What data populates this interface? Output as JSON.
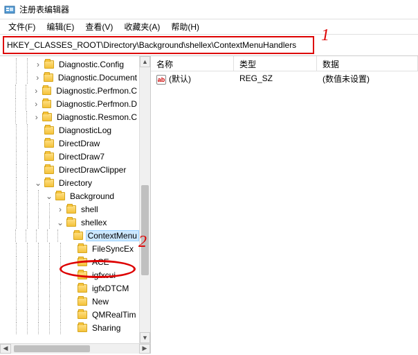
{
  "window": {
    "title": "注册表编辑器"
  },
  "menu": {
    "file": "文件(F)",
    "edit": "编辑(E)",
    "view": "查看(V)",
    "fav": "收藏夹(A)",
    "help": "帮助(H)"
  },
  "address": {
    "value": "HKEY_CLASSES_ROOT\\Directory\\Background\\shellex\\ContextMenuHandlers"
  },
  "tree": {
    "items": [
      {
        "label": "Diagnostic.Config",
        "depth": 3,
        "exp": "closed"
      },
      {
        "label": "Diagnostic.Document",
        "depth": 3,
        "exp": "closed"
      },
      {
        "label": "Diagnostic.Perfmon.C",
        "depth": 3,
        "exp": "closed"
      },
      {
        "label": "Diagnostic.Perfmon.D",
        "depth": 3,
        "exp": "closed"
      },
      {
        "label": "Diagnostic.Resmon.C",
        "depth": 3,
        "exp": "closed"
      },
      {
        "label": "DiagnosticLog",
        "depth": 3,
        "exp": "none"
      },
      {
        "label": "DirectDraw",
        "depth": 3,
        "exp": "none"
      },
      {
        "label": "DirectDraw7",
        "depth": 3,
        "exp": "none"
      },
      {
        "label": "DirectDrawClipper",
        "depth": 3,
        "exp": "none"
      },
      {
        "label": "Directory",
        "depth": 3,
        "exp": "open"
      },
      {
        "label": "Background",
        "depth": 4,
        "exp": "open"
      },
      {
        "label": "shell",
        "depth": 5,
        "exp": "closed"
      },
      {
        "label": "shellex",
        "depth": 5,
        "exp": "open"
      },
      {
        "label": "ContextMenu",
        "depth": 6,
        "exp": "none",
        "selected": true
      },
      {
        "label": "FileSyncEx",
        "depth": 6,
        "exp": "none"
      },
      {
        "label": "ACE",
        "depth": 6,
        "exp": "none"
      },
      {
        "label": "igfxcui",
        "depth": 6,
        "exp": "none"
      },
      {
        "label": "igfxDTCM",
        "depth": 6,
        "exp": "none"
      },
      {
        "label": "New",
        "depth": 6,
        "exp": "none"
      },
      {
        "label": "QMRealTim",
        "depth": 6,
        "exp": "none"
      },
      {
        "label": "Sharing",
        "depth": 6,
        "exp": "none"
      }
    ]
  },
  "columns": {
    "name": "名称",
    "type": "类型",
    "data": "数据"
  },
  "rows": [
    {
      "name": "(默认)",
      "type": "REG_SZ",
      "data": "(数值未设置)"
    }
  ],
  "annot": {
    "one": "1",
    "two": "2"
  }
}
